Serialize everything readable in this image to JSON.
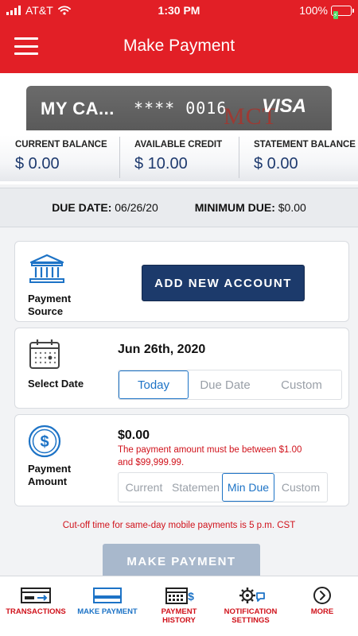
{
  "status": {
    "carrier": "AT&T",
    "time": "1:30 PM",
    "battery": "100%"
  },
  "header": {
    "title": "Make Payment"
  },
  "card": {
    "name": "MY CA...",
    "masked_number": "**** 0016",
    "bank_mark": "MCT",
    "network": "VISA"
  },
  "balances": [
    {
      "label": "CURRENT BALANCE",
      "value": "$ 0.00"
    },
    {
      "label": "AVAILABLE CREDIT",
      "value": "$ 10.00"
    },
    {
      "label": "STATEMENT BALANCE",
      "value": "$ 0.00"
    }
  ],
  "due": {
    "due_date_label": "DUE DATE:",
    "due_date": "06/26/20",
    "min_due_label": "MINIMUM DUE:",
    "min_due": "$0.00"
  },
  "source": {
    "label_line1": "Payment",
    "label_line2": "Source",
    "add_account": "ADD NEW ACCOUNT"
  },
  "date": {
    "label": "Select Date",
    "value": "Jun 26th, 2020",
    "options": [
      "Today",
      "Due Date",
      "Custom"
    ],
    "selected": "Today"
  },
  "amount": {
    "label_line1": "Payment",
    "label_line2": "Amount",
    "value": "$0.00",
    "error_line1": "The payment amount must be between $1.00",
    "error_line2": "and $99,999.99.",
    "options": [
      "Current",
      "Statemen",
      "Min Due",
      "Custom"
    ],
    "selected": "Min Due"
  },
  "cutoff": "Cut-off time for same-day mobile payments is 5 p.m. CST",
  "make_payment": "MAKE PAYMENT",
  "tabs": [
    {
      "line1": "TRANSACTIONS",
      "line2": ""
    },
    {
      "line1": "MAKE PAYMENT",
      "line2": ""
    },
    {
      "line1": "PAYMENT",
      "line2": "HISTORY"
    },
    {
      "line1": "NOTIFICATION",
      "line2": "SETTINGS"
    },
    {
      "line1": "MORE",
      "line2": ""
    }
  ],
  "colors": {
    "brand_red": "#e21f26",
    "navy": "#1c3a6b",
    "accent_blue": "#1d73c6",
    "error_red": "#d0121b"
  }
}
